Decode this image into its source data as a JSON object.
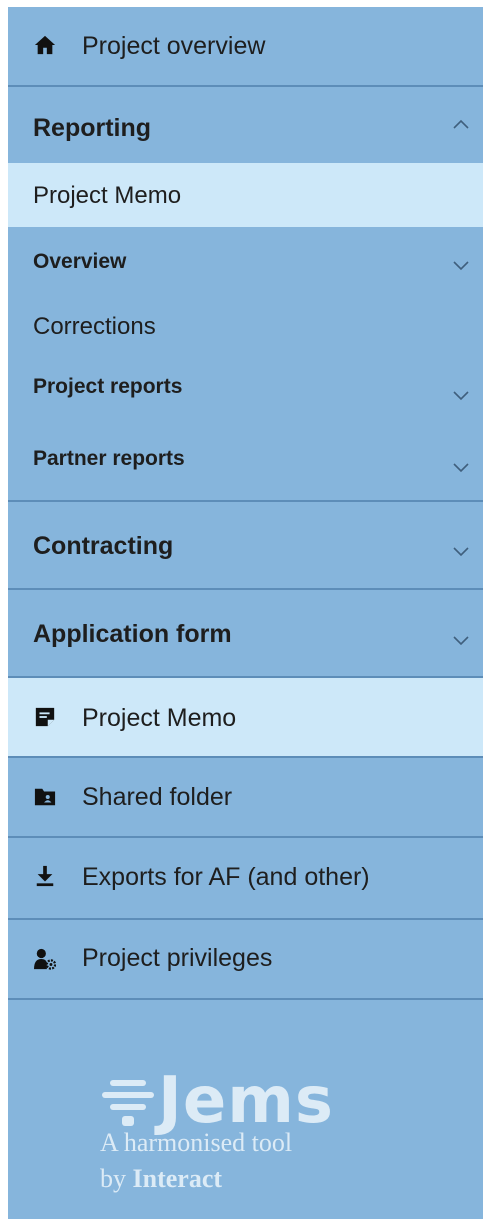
{
  "nav": {
    "project_overview": "Project overview",
    "reporting": {
      "label": "Reporting",
      "items": [
        {
          "label": "Project Memo"
        },
        {
          "label": "Overview"
        },
        {
          "label": "Corrections"
        },
        {
          "label": "Project reports"
        },
        {
          "label": "Partner reports"
        }
      ]
    },
    "contracting": "Contracting",
    "application_form": "Application form",
    "project_memo": "Project Memo",
    "shared_folder": "Shared folder",
    "exports": "Exports for AF (and other)",
    "project_privileges": "Project privileges"
  },
  "icons": {
    "home": "home-icon",
    "memo": "memo-icon",
    "folder": "folder-icon",
    "download": "download-icon",
    "privileges": "user-gear-icon",
    "chevron_up": "chevron-up-icon",
    "chevron_down": "chevron-down-icon"
  },
  "brand": {
    "name": "Jems",
    "tagline_line1": "A harmonised tool",
    "tagline_by": "by",
    "tagline_org": "Interact"
  },
  "colors": {
    "sidebar_bg": "#86b5dc",
    "highlight_bg": "#cde8f9",
    "separator": "#5d8db8",
    "logo_text": "#dcebf6"
  }
}
